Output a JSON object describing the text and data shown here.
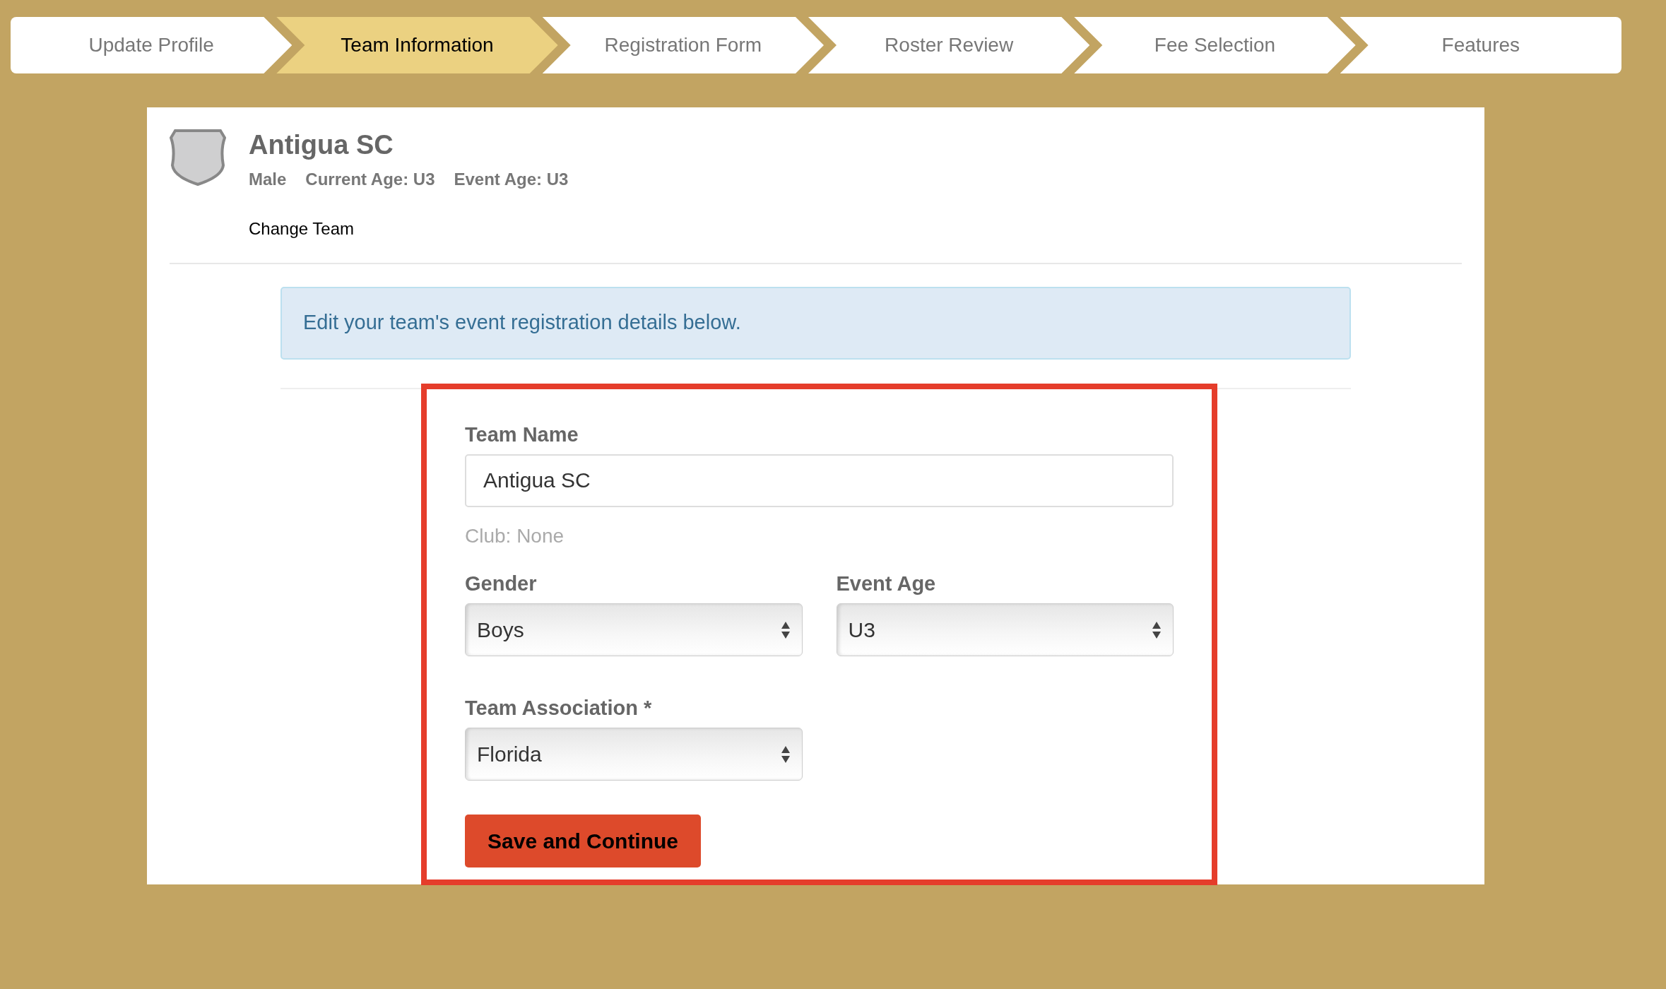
{
  "steps": [
    {
      "label": "Update Profile",
      "selected": false
    },
    {
      "label": "Team Information",
      "selected": true
    },
    {
      "label": "Registration Form",
      "selected": false
    },
    {
      "label": "Roster Review",
      "selected": false
    },
    {
      "label": "Fee Selection",
      "selected": false
    },
    {
      "label": "Features",
      "selected": false
    }
  ],
  "team": {
    "name": "Antigua SC",
    "meta": [
      "Male",
      "Current Age: U3",
      "Event Age: U3"
    ],
    "change_link": "Change Team"
  },
  "info_alert": "Edit your team's event registration details below.",
  "form": {
    "team_name": {
      "label": "Team Name",
      "value": "Antigua SC"
    },
    "club_note": "Club: None",
    "gender": {
      "label": "Gender",
      "value": "Boys"
    },
    "event_age": {
      "label": "Event Age",
      "value": "U3"
    },
    "association": {
      "label": "Team Association *",
      "value": "Florida"
    },
    "submit": "Save and Continue"
  }
}
